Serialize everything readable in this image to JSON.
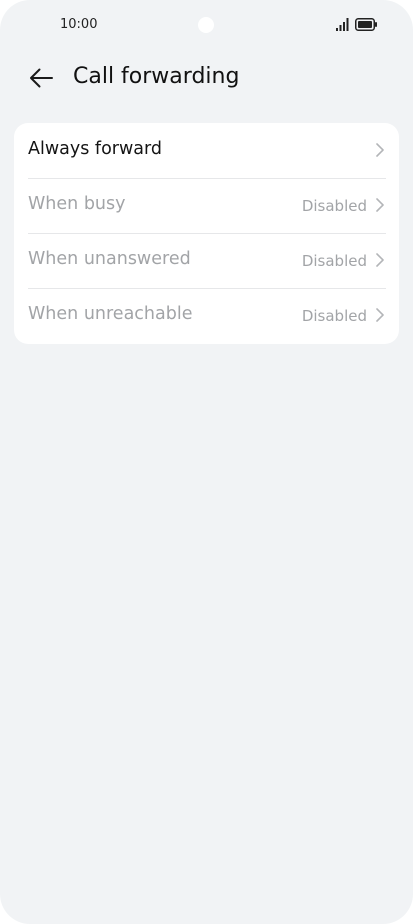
{
  "status_bar": {
    "time": "10:00",
    "signal_icon": "signal-bars-icon",
    "battery_icon": "battery-icon"
  },
  "header": {
    "back_icon": "back-arrow-icon",
    "title": "Call forwarding"
  },
  "forward_options": [
    {
      "label": "Always forward",
      "value": "",
      "enabled": true
    },
    {
      "label": "When busy",
      "value": "Disabled",
      "enabled": false
    },
    {
      "label": "When unanswered",
      "value": "Disabled",
      "enabled": false
    },
    {
      "label": "When unreachable",
      "value": "Disabled",
      "enabled": false
    }
  ],
  "colors": {
    "background": "#f1f3f5",
    "card": "#ffffff",
    "text_primary": "#141414",
    "text_disabled": "#a2a4a7"
  }
}
